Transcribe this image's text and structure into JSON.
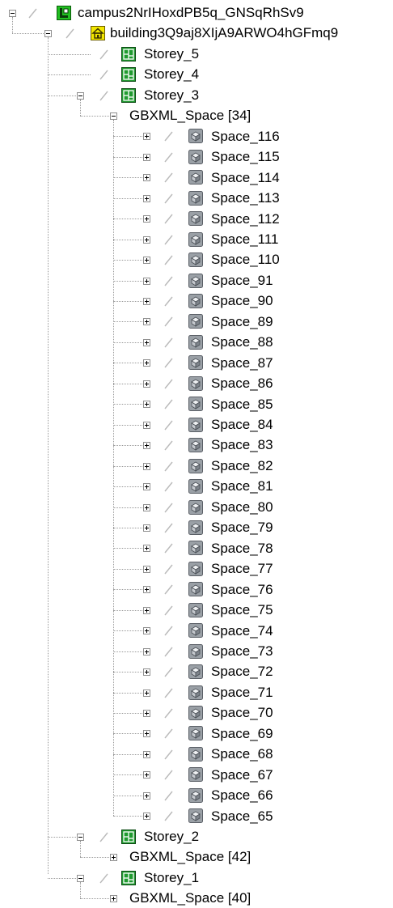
{
  "tree": {
    "campus": {
      "label": "campus2NrIHoxdPB5q_GNSqRhSv9",
      "icon": "campus-icon",
      "expanded": true
    },
    "building": {
      "label": "building3Q9aj8XIjA9ARWO4hGFmq9",
      "icon": "building-icon",
      "expanded": true
    },
    "storey_5": {
      "label": "Storey_5",
      "icon": "storey-icon"
    },
    "storey_4": {
      "label": "Storey_4",
      "icon": "storey-icon"
    },
    "storey_3": {
      "label": "Storey_3",
      "icon": "storey-icon",
      "expanded": true,
      "group": {
        "label": "GBXML_Space [34]",
        "expanded": true
      },
      "spaces": [
        "Space_116",
        "Space_115",
        "Space_114",
        "Space_113",
        "Space_112",
        "Space_111",
        "Space_110",
        "Space_91",
        "Space_90",
        "Space_89",
        "Space_88",
        "Space_87",
        "Space_86",
        "Space_85",
        "Space_84",
        "Space_83",
        "Space_82",
        "Space_81",
        "Space_80",
        "Space_79",
        "Space_78",
        "Space_77",
        "Space_76",
        "Space_75",
        "Space_74",
        "Space_73",
        "Space_72",
        "Space_71",
        "Space_70",
        "Space_69",
        "Space_68",
        "Space_67",
        "Space_66",
        "Space_65"
      ]
    },
    "storey_2": {
      "label": "Storey_2",
      "icon": "storey-icon",
      "expanded": true,
      "group": {
        "label": "GBXML_Space [42]",
        "expanded": false
      }
    },
    "storey_1": {
      "label": "Storey_1",
      "icon": "storey-icon",
      "expanded": true,
      "group": {
        "label": "GBXML_Space [40]",
        "expanded": false
      }
    }
  },
  "colors": {
    "campus_icon": "#22c022",
    "building_icon": "#f2e600",
    "storey_icon": "#1f9a2f",
    "space_icon": "#9aa0a6",
    "tree_line": "#9a9a9a"
  }
}
